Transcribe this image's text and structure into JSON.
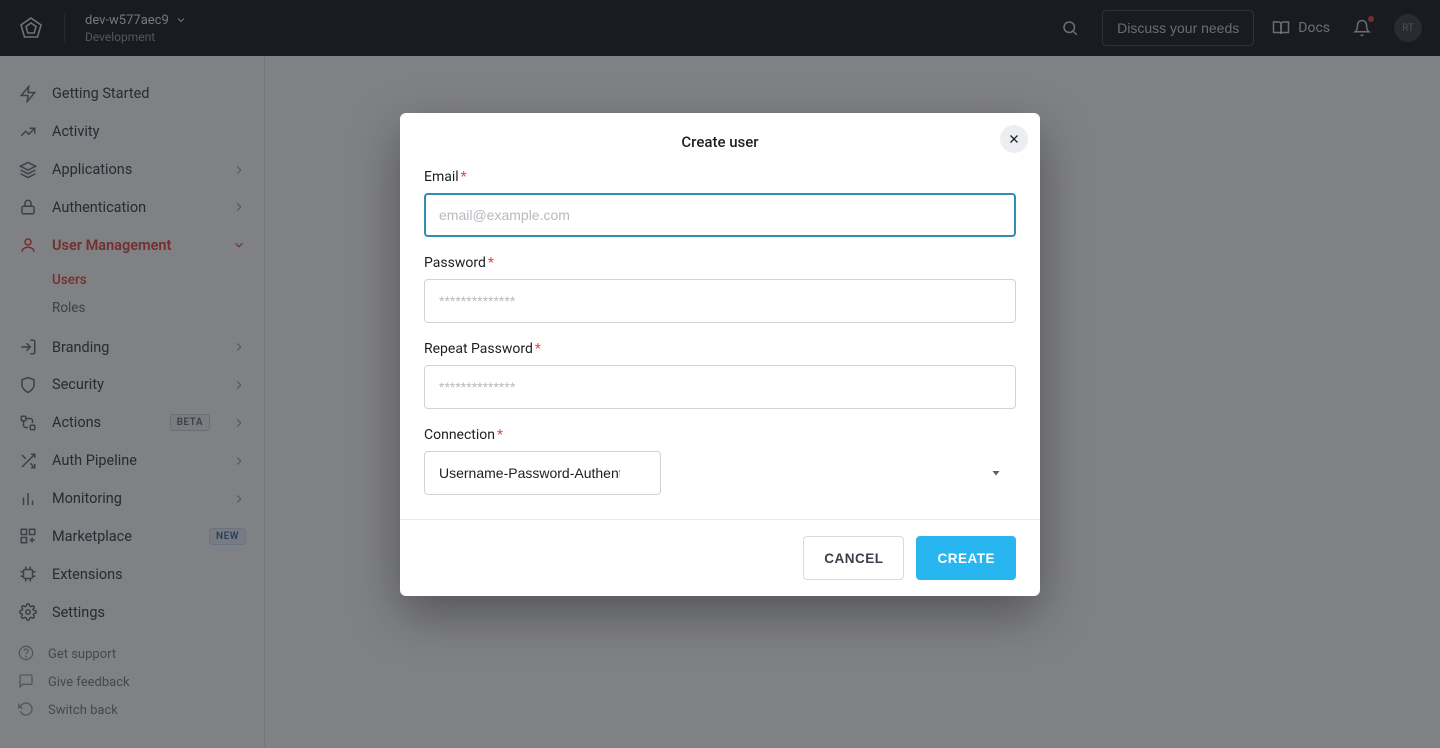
{
  "header": {
    "tenant_name": "dev-w577aec9",
    "tenant_env": "Development",
    "discuss_label": "Discuss your needs",
    "docs_label": "Docs",
    "avatar_initials": "RT"
  },
  "sidebar": {
    "items": [
      {
        "label": "Getting Started"
      },
      {
        "label": "Activity"
      },
      {
        "label": "Applications"
      },
      {
        "label": "Authentication"
      },
      {
        "label": "User Management"
      },
      {
        "label": "Branding"
      },
      {
        "label": "Security"
      },
      {
        "label": "Actions",
        "badge": "BETA"
      },
      {
        "label": "Auth Pipeline"
      },
      {
        "label": "Monitoring"
      },
      {
        "label": "Marketplace",
        "badge": "NEW"
      },
      {
        "label": "Extensions"
      },
      {
        "label": "Settings"
      }
    ],
    "user_mgmt_sub": [
      {
        "label": "Users"
      },
      {
        "label": "Roles"
      }
    ],
    "footer": [
      {
        "label": "Get support"
      },
      {
        "label": "Give feedback"
      },
      {
        "label": "Switch back"
      }
    ]
  },
  "modal": {
    "title": "Create user",
    "email_label": "Email",
    "email_placeholder": "email@example.com",
    "password_label": "Password",
    "password_placeholder": "**************",
    "repeat_label": "Repeat Password",
    "repeat_placeholder": "**************",
    "connection_label": "Connection",
    "connection_value": "Username-Password-Authentication",
    "cancel_label": "CANCEL",
    "create_label": "CREATE"
  }
}
